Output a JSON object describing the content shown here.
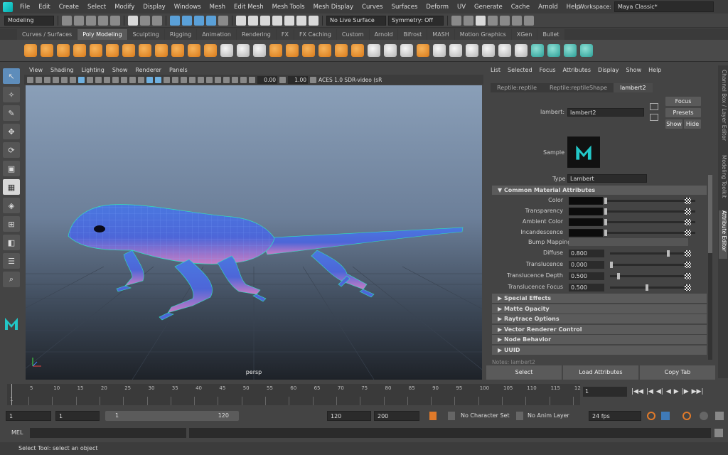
{
  "menubar": {
    "items": [
      "File",
      "Edit",
      "Create",
      "Select",
      "Modify",
      "Display",
      "Windows",
      "Mesh",
      "Edit Mesh",
      "Mesh Tools",
      "Mesh Display",
      "Curves",
      "Surfaces",
      "Deform",
      "UV",
      "Generate",
      "Cache",
      "Arnold",
      "Help"
    ],
    "workspace_label": "Workspace:",
    "workspace_value": "Maya Classic*"
  },
  "statusline": {
    "mode": "Modeling",
    "live_surface": "No Live Surface",
    "symmetry": "Symmetry: Off"
  },
  "shelf": {
    "tabs": [
      "Curves / Surfaces",
      "Poly Modeling",
      "Sculpting",
      "Rigging",
      "Animation",
      "Rendering",
      "FX",
      "FX Caching",
      "Custom",
      "Arnold",
      "Bifrost",
      "MASH",
      "Motion Graphics",
      "XGen",
      "Bullet"
    ],
    "active_tab": "Poly Modeling"
  },
  "viewport": {
    "menu": [
      "View",
      "Shading",
      "Lighting",
      "Show",
      "Renderer",
      "Panels"
    ],
    "near": "0.00",
    "far": "1.00",
    "colorspace": "ACES 1.0 SDR-video (sR",
    "camera": "persp"
  },
  "attr_editor": {
    "menu": [
      "List",
      "Selected",
      "Focus",
      "Attributes",
      "Display",
      "Show",
      "Help"
    ],
    "tabs": [
      "Reptile:reptile",
      "Reptile:reptileShape",
      "lambert2"
    ],
    "active_tab": "lambert2",
    "node_label": "lambert:",
    "node_name": "lambert2",
    "focus_btn": "Focus",
    "presets_btn": "Presets",
    "show_btn": "Show",
    "hide_btn": "Hide",
    "sample_label": "Sample",
    "type_label": "Type",
    "type_value": "Lambert",
    "common_section": "Common Material Attributes",
    "color_rows": [
      {
        "label": "Color",
        "knob": 0.0
      },
      {
        "label": "Transparency",
        "knob": 0.0
      },
      {
        "label": "Ambient Color",
        "knob": 0.0
      },
      {
        "label": "Incandescence",
        "knob": 0.0
      }
    ],
    "bump_label": "Bump Mapping",
    "num_rows": [
      {
        "label": "Diffuse",
        "value": "0.800",
        "knob": 0.8
      },
      {
        "label": "Translucence",
        "value": "0.000",
        "knob": 0.0
      },
      {
        "label": "Translucence Depth",
        "value": "0.500",
        "knob": 0.1
      },
      {
        "label": "Translucence Focus",
        "value": "0.500",
        "knob": 0.5
      }
    ],
    "sections": [
      "Special Effects",
      "Matte Opacity",
      "Raytrace Options",
      "Vector Renderer Control",
      "Node Behavior",
      "UUID"
    ],
    "notes": "Notes: lambert2",
    "bottom_buttons": [
      "Select",
      "Load Attributes",
      "Copy Tab"
    ]
  },
  "sidetabs": [
    "Channel Box / Layer Editor",
    "Modeling Toolkit",
    "Attribute Editor"
  ],
  "timeslider": {
    "ticks": [
      "5",
      "10",
      "15",
      "20",
      "25",
      "30",
      "35",
      "40",
      "45",
      "50",
      "55",
      "60",
      "65",
      "70",
      "75",
      "80",
      "85",
      "90",
      "95",
      "100",
      "105",
      "110",
      "115",
      "12"
    ],
    "start_tick": "1",
    "current_frame": "1"
  },
  "range": {
    "start": "1",
    "playback_start": "1",
    "bar_start": "1",
    "bar_end": "120",
    "playback_end": "120",
    "end": "200",
    "character_set": "No Character Set",
    "anim_layer": "No Anim Layer",
    "fps": "24 fps"
  },
  "cmd": {
    "lang": "MEL"
  },
  "help": "Select Tool: select an object"
}
